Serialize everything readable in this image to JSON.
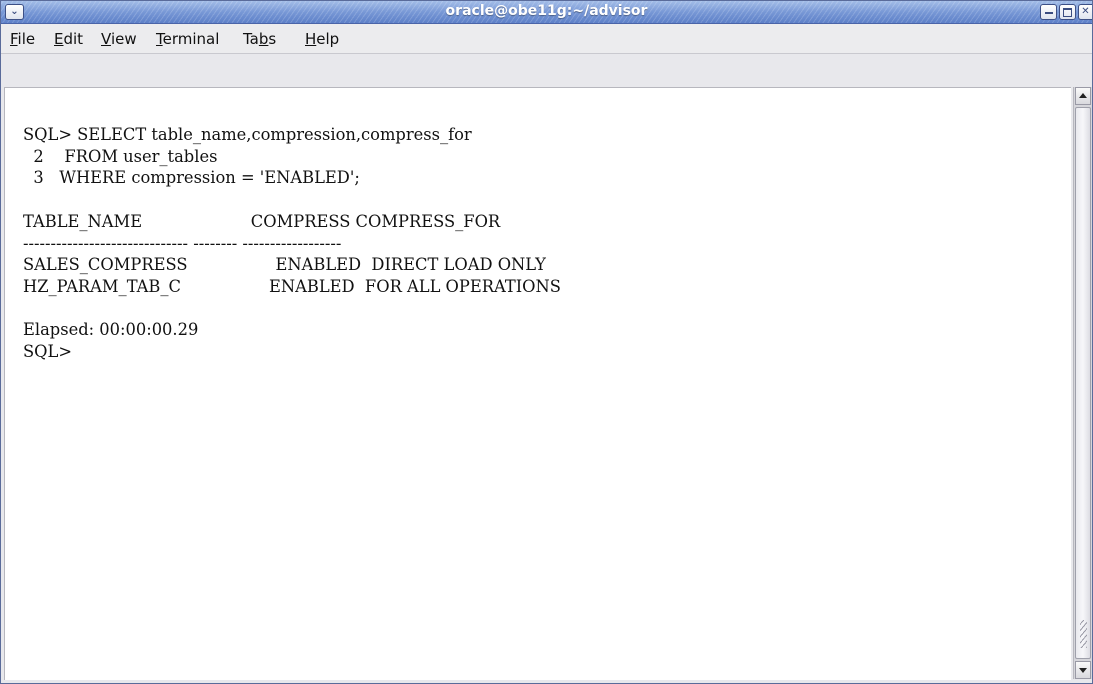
{
  "window": {
    "title": "oracle@obe11g:~/advisor"
  },
  "menu": {
    "file": {
      "mnemonic": "F",
      "rest": "ile"
    },
    "edit": {
      "mnemonic": "E",
      "rest": "dit"
    },
    "view": {
      "mnemonic": "V",
      "rest": "iew"
    },
    "terminal": {
      "mnemonic": "T",
      "rest": "erminal"
    },
    "tabs": {
      "before": "Ta",
      "mnemonic": "b",
      "after": "s"
    },
    "help": {
      "mnemonic": "H",
      "rest": "elp"
    }
  },
  "terminal": {
    "lines": [
      "SQL> SELECT table_name,compression,compress_for",
      "  2    FROM user_tables",
      "  3   WHERE compression = 'ENABLED';",
      "",
      "TABLE_NAME                     COMPRESS COMPRESS_FOR",
      "------------------------------ -------- ------------------",
      "SALES_COMPRESS                 ENABLED  DIRECT LOAD ONLY",
      "HZ_PARAM_TAB_C                 ENABLED  FOR ALL OPERATIONS",
      "",
      "Elapsed: 00:00:00.29",
      "SQL>"
    ]
  },
  "icons": {
    "window_menu": "chevron-down-icon",
    "minimize": "minimize-icon",
    "maximize": "maximize-icon",
    "close": "close-icon",
    "scroll_up": "arrow-up-icon",
    "scroll_down": "arrow-down-icon"
  },
  "colors": {
    "titlebar": "#7898d6",
    "terminal_bg": "#ffffff",
    "terminal_fg": "#111111"
  }
}
